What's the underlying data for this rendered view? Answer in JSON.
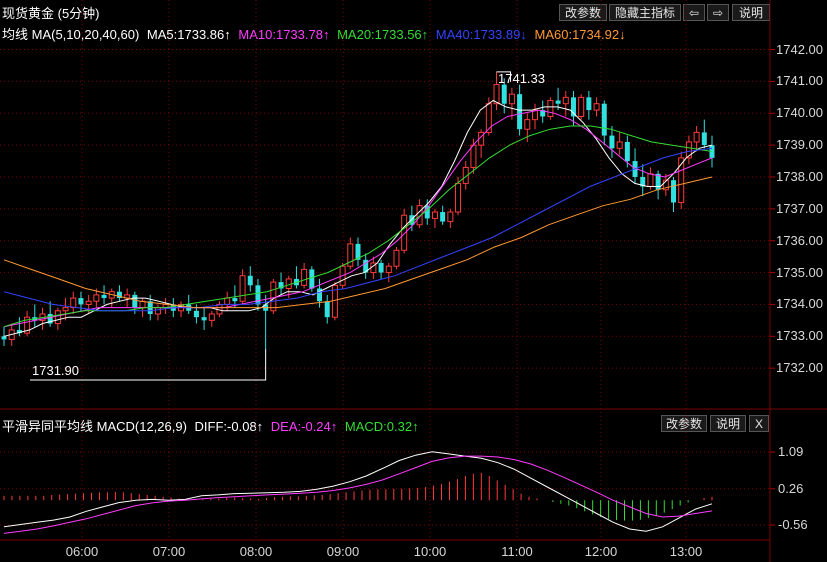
{
  "header": {
    "title": "现货黄金 (5分钟)",
    "buttons": [
      "改参数",
      "隐藏主指标",
      "⇦",
      "⇨",
      "说明"
    ]
  },
  "ma_legend": {
    "label": "均线 MA(5,10,20,40,60)",
    "items": [
      {
        "text": "MA5:1733.86↑",
        "color": "#ffffff"
      },
      {
        "text": "MA10:1733.78↑",
        "color": "#ff3cff"
      },
      {
        "text": "MA20:1733.56↑",
        "color": "#33dd33"
      },
      {
        "text": "MA40:1733.89↓",
        "color": "#3344ff"
      },
      {
        "text": "MA60:1734.92↓",
        "color": "#ff9933"
      }
    ]
  },
  "macd_header": {
    "label": "平滑异同平均线 MACD(12,26,9)",
    "items": [
      {
        "text": "DIFF:-0.08↑",
        "color": "#ffffff"
      },
      {
        "text": "DEA:-0.24↑",
        "color": "#ff3cff"
      },
      {
        "text": "MACD:0.32↑",
        "color": "#33dd33"
      }
    ],
    "buttons": [
      "改参数",
      "说明",
      "X"
    ]
  },
  "annotations": {
    "high": "1741.33",
    "low": "1731.90"
  },
  "colors": {
    "up": "#ff3b3b",
    "down": "#33e0e0",
    "grid": "#7a0000"
  },
  "chart_data": [
    {
      "type": "candlestick",
      "x_ticks": [
        "06:00",
        "07:00",
        "08:00",
        "09:00",
        "10:00",
        "11:00",
        "12:00",
        "13:00"
      ],
      "y_ticks": [
        1732.0,
        1733.0,
        1734.0,
        1735.0,
        1736.0,
        1737.0,
        1738.0,
        1739.0,
        1740.0,
        1741.0,
        1742.0
      ],
      "ylim": [
        1731.0,
        1742.3
      ],
      "candles": [
        [
          1733.0,
          1733.3,
          1732.7,
          1732.9
        ],
        [
          1732.9,
          1733.4,
          1732.7,
          1733.2
        ],
        [
          1733.2,
          1733.6,
          1733.0,
          1733.1
        ],
        [
          1733.1,
          1733.8,
          1733.0,
          1733.6
        ],
        [
          1733.6,
          1734.0,
          1733.3,
          1733.5
        ],
        [
          1733.5,
          1733.9,
          1733.2,
          1733.7
        ],
        [
          1733.7,
          1734.1,
          1733.3,
          1733.4
        ],
        [
          1733.4,
          1733.9,
          1733.2,
          1733.8
        ],
        [
          1733.8,
          1734.2,
          1733.5,
          1733.9
        ],
        [
          1733.9,
          1734.4,
          1733.7,
          1734.2
        ],
        [
          1734.2,
          1734.4,
          1733.8,
          1734.0
        ],
        [
          1734.0,
          1734.3,
          1733.7,
          1734.1
        ],
        [
          1734.1,
          1734.5,
          1733.9,
          1734.3
        ],
        [
          1734.3,
          1734.6,
          1734.0,
          1734.2
        ],
        [
          1734.2,
          1734.5,
          1733.9,
          1734.4
        ],
        [
          1734.4,
          1734.6,
          1734.1,
          1734.2
        ],
        [
          1734.2,
          1734.5,
          1733.9,
          1734.3
        ],
        [
          1734.3,
          1734.4,
          1733.7,
          1733.9
        ],
        [
          1733.9,
          1734.2,
          1733.6,
          1734.1
        ],
        [
          1734.1,
          1734.3,
          1733.5,
          1733.7
        ],
        [
          1733.7,
          1734.0,
          1733.5,
          1733.9
        ],
        [
          1733.9,
          1734.2,
          1733.7,
          1734.0
        ],
        [
          1734.0,
          1734.2,
          1733.6,
          1733.8
        ],
        [
          1733.8,
          1734.1,
          1733.6,
          1734.0
        ],
        [
          1734.0,
          1734.3,
          1733.7,
          1733.8
        ],
        [
          1733.8,
          1734.0,
          1733.4,
          1733.6
        ],
        [
          1733.6,
          1733.9,
          1733.2,
          1733.5
        ],
        [
          1733.5,
          1733.8,
          1733.3,
          1733.7
        ],
        [
          1733.7,
          1734.1,
          1733.6,
          1734.0
        ],
        [
          1734.0,
          1734.4,
          1733.8,
          1734.2
        ],
        [
          1734.2,
          1734.6,
          1733.9,
          1734.1
        ],
        [
          1734.1,
          1735.1,
          1734.0,
          1734.9
        ],
        [
          1734.9,
          1735.2,
          1734.4,
          1734.6
        ],
        [
          1734.6,
          1734.8,
          1733.8,
          1734.0
        ],
        [
          1734.0,
          1734.3,
          1732.6,
          1733.8
        ],
        [
          1733.8,
          1734.8,
          1733.7,
          1734.7
        ],
        [
          1734.7,
          1735.0,
          1734.3,
          1734.5
        ],
        [
          1734.5,
          1734.9,
          1734.2,
          1734.8
        ],
        [
          1734.8,
          1735.2,
          1734.5,
          1734.6
        ],
        [
          1734.6,
          1735.3,
          1734.5,
          1735.1
        ],
        [
          1735.1,
          1735.2,
          1734.4,
          1734.5
        ],
        [
          1734.5,
          1734.8,
          1733.9,
          1734.1
        ],
        [
          1734.1,
          1734.3,
          1733.4,
          1733.6
        ],
        [
          1733.6,
          1734.7,
          1733.5,
          1734.6
        ],
        [
          1734.6,
          1735.3,
          1734.5,
          1735.2
        ],
        [
          1735.2,
          1736.1,
          1735.1,
          1735.9
        ],
        [
          1735.9,
          1736.1,
          1735.2,
          1735.4
        ],
        [
          1735.4,
          1735.6,
          1734.8,
          1735.0
        ],
        [
          1735.0,
          1735.5,
          1734.8,
          1735.3
        ],
        [
          1735.3,
          1735.4,
          1734.8,
          1735.0
        ],
        [
          1735.0,
          1735.3,
          1734.7,
          1735.2
        ],
        [
          1735.2,
          1735.8,
          1735.1,
          1735.7
        ],
        [
          1735.7,
          1737.0,
          1735.6,
          1736.8
        ],
        [
          1736.8,
          1737.1,
          1736.3,
          1736.5
        ],
        [
          1736.5,
          1737.3,
          1736.4,
          1737.1
        ],
        [
          1737.1,
          1737.3,
          1736.5,
          1736.7
        ],
        [
          1736.7,
          1737.0,
          1736.4,
          1736.9
        ],
        [
          1736.9,
          1737.1,
          1736.5,
          1736.6
        ],
        [
          1736.6,
          1737.0,
          1736.4,
          1736.9
        ],
        [
          1736.9,
          1738.0,
          1736.8,
          1737.8
        ],
        [
          1737.8,
          1738.5,
          1737.6,
          1738.3
        ],
        [
          1738.3,
          1739.2,
          1738.1,
          1739.0
        ],
        [
          1739.0,
          1739.5,
          1738.6,
          1739.4
        ],
        [
          1739.4,
          1740.5,
          1739.3,
          1740.3
        ],
        [
          1740.3,
          1741.3,
          1740.1,
          1740.9
        ],
        [
          1740.9,
          1741.1,
          1740.0,
          1740.3
        ],
        [
          1740.3,
          1740.8,
          1739.8,
          1740.6
        ],
        [
          1740.6,
          1740.9,
          1739.3,
          1739.5
        ],
        [
          1739.5,
          1740.0,
          1739.1,
          1739.8
        ],
        [
          1739.8,
          1740.3,
          1739.5,
          1740.1
        ],
        [
          1740.1,
          1740.4,
          1739.7,
          1739.9
        ],
        [
          1739.9,
          1740.5,
          1739.8,
          1740.4
        ],
        [
          1740.4,
          1740.8,
          1740.1,
          1740.3
        ],
        [
          1740.3,
          1740.7,
          1739.9,
          1740.5
        ],
        [
          1740.5,
          1740.7,
          1739.6,
          1739.9
        ],
        [
          1739.9,
          1740.6,
          1739.8,
          1740.5
        ],
        [
          1740.5,
          1740.7,
          1739.8,
          1740.1
        ],
        [
          1740.1,
          1740.5,
          1739.9,
          1740.3
        ],
        [
          1740.3,
          1740.4,
          1739.0,
          1739.3
        ],
        [
          1739.3,
          1739.6,
          1738.6,
          1738.9
        ],
        [
          1738.9,
          1739.4,
          1738.7,
          1739.1
        ],
        [
          1739.1,
          1739.3,
          1738.3,
          1738.5
        ],
        [
          1738.5,
          1738.9,
          1737.8,
          1738.0
        ],
        [
          1738.0,
          1738.4,
          1737.4,
          1737.7
        ],
        [
          1737.7,
          1738.3,
          1737.6,
          1738.1
        ],
        [
          1738.1,
          1738.2,
          1737.3,
          1737.6
        ],
        [
          1737.6,
          1738.1,
          1737.4,
          1737.9
        ],
        [
          1737.9,
          1738.0,
          1736.9,
          1737.2
        ],
        [
          1737.2,
          1738.8,
          1737.0,
          1738.6
        ],
        [
          1738.6,
          1739.3,
          1738.4,
          1739.1
        ],
        [
          1739.1,
          1739.6,
          1738.8,
          1739.4
        ],
        [
          1739.4,
          1739.8,
          1738.9,
          1739.0
        ],
        [
          1739.0,
          1739.3,
          1738.3,
          1738.6
        ]
      ],
      "ma": {
        "MA5": {
          "color": "#ffffff",
          "values": [
            1733.0,
            1733.1,
            1733.2,
            1733.4,
            1733.5,
            1733.6,
            1733.6,
            1733.8,
            1734.0,
            1734.1,
            1734.2,
            1734.2,
            1734.1,
            1734.0,
            1733.9,
            1733.9,
            1733.9,
            1733.8,
            1733.8,
            1733.8,
            1733.9,
            1734.2,
            1734.4,
            1734.4,
            1734.3,
            1734.5,
            1734.7,
            1734.9,
            1735.0,
            1735.3,
            1735.9,
            1736.4,
            1736.8,
            1737.2,
            1737.7,
            1738.5,
            1739.4,
            1740.1,
            1740.4,
            1740.2,
            1740.1,
            1740.1,
            1740.2,
            1740.2,
            1740.1,
            1739.7,
            1739.2,
            1738.6,
            1738.1,
            1737.8,
            1737.7,
            1737.7,
            1738.1,
            1738.6,
            1738.9,
            1739.0
          ]
        },
        "MA10": {
          "color": "#ff3cff",
          "values": [
            1733.3,
            1733.4,
            1733.5,
            1733.6,
            1733.7,
            1733.8,
            1733.9,
            1733.9,
            1733.9,
            1733.9,
            1733.9,
            1733.9,
            1733.9,
            1733.9,
            1733.9,
            1734.0,
            1734.1,
            1734.2,
            1734.3,
            1734.4,
            1734.6,
            1734.8,
            1735.0,
            1735.3,
            1735.6,
            1736.0,
            1736.5,
            1737.1,
            1737.8,
            1738.5,
            1739.1,
            1739.6,
            1739.9,
            1740.0,
            1740.1,
            1740.0,
            1739.8,
            1739.5,
            1739.1,
            1738.7,
            1738.3,
            1738.1,
            1738.0,
            1738.2,
            1738.4,
            1738.6
          ]
        },
        "MA20": {
          "color": "#33dd33",
          "values": [
            1733.3,
            1733.5,
            1733.6,
            1733.7,
            1733.8,
            1733.8,
            1733.8,
            1733.9,
            1733.9,
            1734.0,
            1734.1,
            1734.2,
            1734.3,
            1734.4,
            1734.6,
            1734.8,
            1735.0,
            1735.3,
            1735.6,
            1736.0,
            1736.5,
            1737.0,
            1737.6,
            1738.1,
            1738.6,
            1739.0,
            1739.3,
            1739.5,
            1739.6,
            1739.6,
            1739.5,
            1739.3,
            1739.1,
            1739.0,
            1738.9,
            1738.8
          ]
        },
        "MA40": {
          "color": "#3344ff",
          "values": [
            1734.4,
            1734.2,
            1734.0,
            1733.9,
            1733.8,
            1733.8,
            1733.8,
            1733.9,
            1733.9,
            1734.0,
            1734.0,
            1734.1,
            1734.2,
            1734.4,
            1734.5,
            1734.7,
            1734.9,
            1735.2,
            1735.5,
            1735.8,
            1736.1,
            1736.5,
            1736.9,
            1737.3,
            1737.7,
            1738.0,
            1738.3,
            1738.6,
            1738.8,
            1738.9
          ]
        },
        "MA60": {
          "color": "#ff9933",
          "values": [
            1735.4,
            1735.1,
            1734.8,
            1734.5,
            1734.3,
            1734.1,
            1734.0,
            1733.9,
            1733.9,
            1733.9,
            1733.9,
            1734.0,
            1734.1,
            1734.3,
            1734.5,
            1734.8,
            1735.1,
            1735.4,
            1735.8,
            1736.1,
            1736.5,
            1736.8,
            1737.1,
            1737.3,
            1737.6,
            1737.8,
            1738.0
          ]
        }
      }
    },
    {
      "type": "bar",
      "name": "MACD",
      "y_ticks": [
        1.09,
        0.26,
        -0.56
      ],
      "ylim": [
        -0.9,
        1.5
      ],
      "bars": [
        0.1,
        0.1,
        0.1,
        0.1,
        0.1,
        0.1,
        0.12,
        0.13,
        0.14,
        0.15,
        0.16,
        0.17,
        0.18,
        0.18,
        0.19,
        0.18,
        0.16,
        0.14,
        0.12,
        0.1,
        0.08,
        0.06,
        0.04,
        0.03,
        0.02,
        0.02,
        0.03,
        0.04,
        0.05,
        0.06,
        0.05,
        0.04,
        0.03,
        0.05,
        0.07,
        0.08,
        0.09,
        0.09,
        0.1,
        0.11,
        0.12,
        0.14,
        0.16,
        0.18,
        0.2,
        0.22,
        0.24,
        0.25,
        0.25,
        0.26,
        0.26,
        0.27,
        0.28,
        0.3,
        0.33,
        0.37,
        0.42,
        0.48,
        0.55,
        0.6,
        0.62,
        0.55,
        0.45,
        0.35,
        0.25,
        0.15,
        0.08,
        0.04,
        0.0,
        -0.04,
        -0.08,
        -0.12,
        -0.18,
        -0.25,
        -0.32,
        -0.38,
        -0.42,
        -0.45,
        -0.46,
        -0.46,
        -0.44,
        -0.4,
        -0.35,
        -0.28,
        -0.2,
        -0.12,
        -0.05,
        0.0,
        0.05,
        0.08
      ],
      "series": [
        {
          "name": "DIFF",
          "color": "#ffffff",
          "values": [
            -0.6,
            -0.55,
            -0.5,
            -0.45,
            -0.38,
            -0.25,
            -0.15,
            -0.05,
            0.0,
            0.02,
            0.0,
            0.02,
            0.1,
            0.12,
            0.15,
            0.16,
            0.17,
            0.18,
            0.2,
            0.25,
            0.32,
            0.42,
            0.55,
            0.72,
            0.9,
            1.02,
            1.1,
            1.05,
            1.0,
            0.95,
            0.85,
            0.7,
            0.5,
            0.3,
            0.1,
            -0.1,
            -0.3,
            -0.5,
            -0.65,
            -0.7,
            -0.6,
            -0.4,
            -0.2,
            -0.08
          ]
        },
        {
          "name": "DEA",
          "color": "#ff3cff",
          "values": [
            -0.75,
            -0.7,
            -0.65,
            -0.58,
            -0.5,
            -0.42,
            -0.32,
            -0.22,
            -0.12,
            -0.06,
            -0.02,
            0.0,
            0.03,
            0.06,
            0.08,
            0.1,
            0.12,
            0.14,
            0.16,
            0.18,
            0.22,
            0.28,
            0.36,
            0.46,
            0.6,
            0.74,
            0.88,
            0.96,
            1.0,
            1.0,
            0.98,
            0.92,
            0.82,
            0.68,
            0.52,
            0.35,
            0.18,
            0.0,
            -0.15,
            -0.3,
            -0.38,
            -0.36,
            -0.3,
            -0.24
          ]
        }
      ]
    }
  ]
}
